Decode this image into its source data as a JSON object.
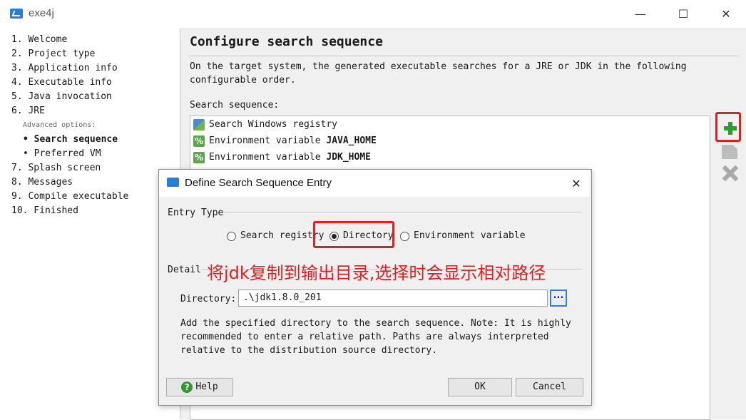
{
  "window": {
    "title": "exe4j",
    "minimize": "—",
    "maximize": "☐",
    "close": "✕"
  },
  "steps": [
    {
      "label": "1. Welcome"
    },
    {
      "label": "2. Project type"
    },
    {
      "label": "3. Application info"
    },
    {
      "label": "4. Executable info"
    },
    {
      "label": "5. Java invocation"
    },
    {
      "label": "6. JRE"
    },
    {
      "label": "Advanced options:"
    },
    {
      "label": "• Search sequence"
    },
    {
      "label": "• Preferred VM"
    },
    {
      "label": "7. Splash screen"
    },
    {
      "label": "8. Messages"
    },
    {
      "label": "9. Compile executable"
    },
    {
      "label": "10. Finished"
    }
  ],
  "page": {
    "title": "Configure search sequence",
    "description": "On the target system, the generated executable searches for a JRE or JDK in the following configurable order.",
    "sequence_label": "Search sequence:",
    "sequence": [
      {
        "icon": "registry-icon",
        "prefix": "Search Windows registry",
        "value": ""
      },
      {
        "icon": "env-variable-icon",
        "prefix": "Environment variable ",
        "value": "JAVA_HOME"
      },
      {
        "icon": "env-variable-icon",
        "prefix": "Environment variable ",
        "value": "JDK_HOME"
      }
    ]
  },
  "dialog": {
    "title": "Define Search Sequence Entry",
    "close": "✕",
    "entry_type_label": "Entry Type",
    "options": [
      {
        "label": "Search registry",
        "selected": false
      },
      {
        "label": "Directory",
        "selected": true
      },
      {
        "label": "Environment variable",
        "selected": false
      }
    ],
    "detail_label": "Detail",
    "annotation": "将jdk复制到输出目录,选择时会显示相对路径",
    "directory_label": "Directory:",
    "directory_value": ".\\jdk1.8.0_201",
    "browse_label": "...",
    "help_text": "Add the specified directory to the search sequence. Note: It is highly recommended to enter a relative path. Paths are always interpreted relative to the distribution source directory.",
    "help_button": "Help",
    "ok_button": "OK",
    "cancel_button": "Cancel"
  },
  "colors": {
    "highlight": "#e02020",
    "add": "#2d9d2d"
  }
}
